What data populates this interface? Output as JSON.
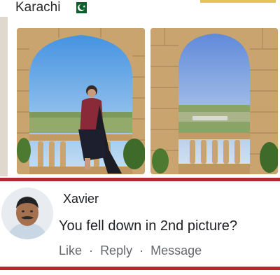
{
  "post": {
    "location": "Karachi",
    "flag_icon": "pakistan-flag-icon",
    "colors": {
      "flag_green": "#0b5f2c",
      "divider": "#b5282f",
      "accent": "#e2c458"
    }
  },
  "comment": {
    "author": "Xavier",
    "text": "You fell down in 2nd picture?",
    "actions": {
      "like": "Like",
      "reply": "Reply",
      "message": "Message",
      "separator": "·"
    }
  }
}
